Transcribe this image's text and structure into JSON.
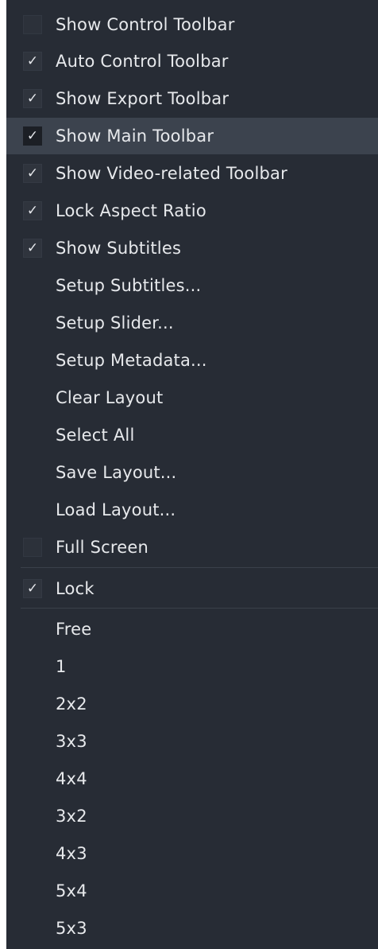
{
  "menu": {
    "items": [
      {
        "label": "Show Control Toolbar",
        "check": "empty"
      },
      {
        "label": "Auto Control Toolbar",
        "check": "checked"
      },
      {
        "label": "Show Export Toolbar",
        "check": "checked"
      },
      {
        "label": "Show Main Toolbar",
        "check": "checked",
        "highlighted": true
      },
      {
        "label": "Show Video-related Toolbar",
        "check": "checked"
      },
      {
        "label": "Lock Aspect Ratio",
        "check": "checked"
      },
      {
        "label": "Show Subtitles",
        "check": "checked"
      },
      {
        "label": "Setup Subtitles...",
        "check": "none"
      },
      {
        "label": "Setup Slider...",
        "check": "none"
      },
      {
        "label": "Setup Metadata...",
        "check": "none"
      },
      {
        "label": "Clear Layout",
        "check": "none"
      },
      {
        "label": "Select All",
        "check": "none"
      },
      {
        "label": "Save Layout...",
        "check": "none"
      },
      {
        "label": "Load Layout...",
        "check": "none"
      },
      {
        "label": "Full Screen",
        "check": "empty"
      }
    ],
    "lock_item": {
      "label": "Lock",
      "check": "checked"
    },
    "grid_items": [
      {
        "label": "Free"
      },
      {
        "label": "1"
      },
      {
        "label": "2x2"
      },
      {
        "label": "3x3"
      },
      {
        "label": "4x4"
      },
      {
        "label": "3x2"
      },
      {
        "label": "4x3"
      },
      {
        "label": "5x4"
      },
      {
        "label": "5x3"
      }
    ],
    "check_glyph": "✓",
    "colors": {
      "background": "#272c35",
      "highlight": "#3c434e",
      "text": "#e7e9ec"
    }
  }
}
